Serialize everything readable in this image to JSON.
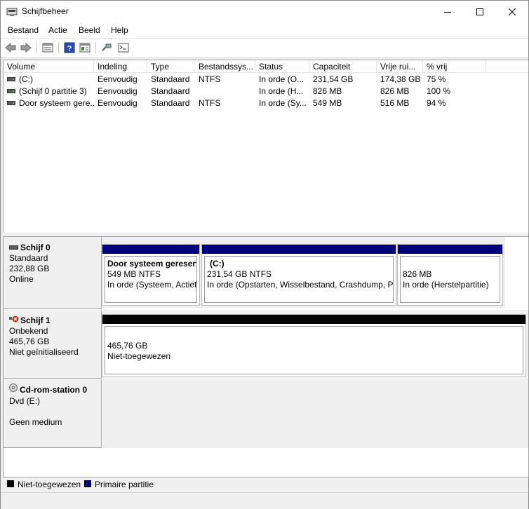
{
  "window": {
    "title": "Schijfbeheer",
    "icon": "disk-management-icon"
  },
  "menu": [
    {
      "label": "Bestand"
    },
    {
      "label": "Actie"
    },
    {
      "label": "Beeld"
    },
    {
      "label": "Help"
    }
  ],
  "toolbar": {
    "icons": [
      "back-arrow-icon",
      "forward-arrow-icon",
      "volume-list-icon",
      "help-icon",
      "properties-icon",
      "connect-icon",
      "console-icon"
    ]
  },
  "volume_list": {
    "columns": [
      "Volume",
      "Indeling",
      "Type",
      "Bestandssys...",
      "Status",
      "Capaciteit",
      "Vrije rui...",
      "% vrij"
    ],
    "rows": [
      {
        "volume": "(C:)",
        "indeling": "Eenvoudig",
        "type": "Standaard",
        "fs": "NTFS",
        "status": "In orde (O...",
        "capacity": "231,54 GB",
        "free": "174,38 GB",
        "pct": "75 %"
      },
      {
        "volume": "(Schijf 0 partitie 3)",
        "indeling": "Eenvoudig",
        "type": "Standaard",
        "fs": "",
        "status": "In orde (H...",
        "capacity": "826 MB",
        "free": "826 MB",
        "pct": "100 %"
      },
      {
        "volume": "Door systeem gere...",
        "indeling": "Eenvoudig",
        "type": "Standaard",
        "fs": "NTFS",
        "status": "In orde (Sy...",
        "capacity": "549 MB",
        "free": "516 MB",
        "pct": "94 %"
      }
    ]
  },
  "disks": {
    "disk0": {
      "name": "Schijf 0",
      "kind": "Standaard",
      "size": "232,88 GB",
      "state": "Online",
      "partitions": [
        {
          "title": "Door systeem gereserv",
          "size": "549 MB NTFS",
          "status": "In orde (Systeem, Actief,"
        },
        {
          "title": "(C:)",
          "size": "231,54 GB NTFS",
          "status": "In orde (Opstarten, Wisselbestand, Crashdump, Pr"
        },
        {
          "title": "",
          "size": "826 MB",
          "status": "In orde (Herstelpartitie)"
        }
      ]
    },
    "disk1": {
      "name": "Schijf 1",
      "kind": "Onbekend",
      "size": "465,76 GB",
      "state": "Niet geïnitialiseerd",
      "partitions": [
        {
          "size": "465,76 GB",
          "status": "Niet-toegewezen"
        }
      ]
    },
    "cdrom0": {
      "name": "Cd-rom-station 0",
      "kind": "Dvd (E:)",
      "state": "Geen medium"
    }
  },
  "legend": [
    {
      "label": "Niet-toegewezen",
      "color": "#000000"
    },
    {
      "label": "Primaire partitie",
      "color": "#00007f"
    }
  ],
  "colors": {
    "primary_partition": "#00007f",
    "unallocated": "#000000",
    "error_badge": "#c42b1c"
  }
}
